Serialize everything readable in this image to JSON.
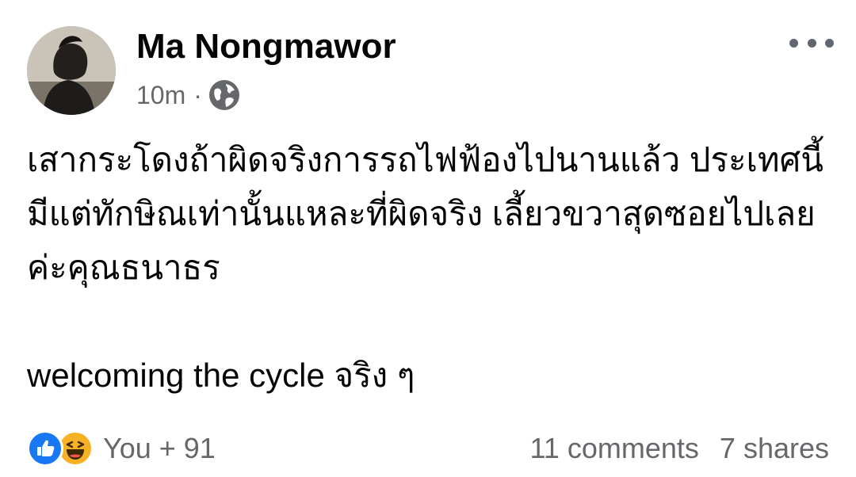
{
  "post": {
    "author": "Ma Nongmawor",
    "time": "10m",
    "separator": "·",
    "privacy_icon": "globe-icon",
    "more_icon": "more-horizontal-icon",
    "text_paragraph_1": "เสากระโดงถ้าผิดจริงการรถไฟฟ้องไปนานแล้ว ประเทศนี้มีแต่ทักษิณเท่านั้นแหละที่ผิดจริง เลี้ยวขวาสุดซอยไปเลยค่ะคุณธนาธร",
    "text_paragraph_2": "welcoming the cycle จริง ๆ"
  },
  "footer": {
    "reaction_icons": [
      "like-icon",
      "haha-icon"
    ],
    "reaction_count": "You + 91",
    "comments": "11 comments",
    "shares": "7 shares"
  },
  "colors": {
    "text": "#050505",
    "secondary": "#65676b",
    "like_blue": "#1877f2",
    "haha_yellow": "#f7b125"
  }
}
